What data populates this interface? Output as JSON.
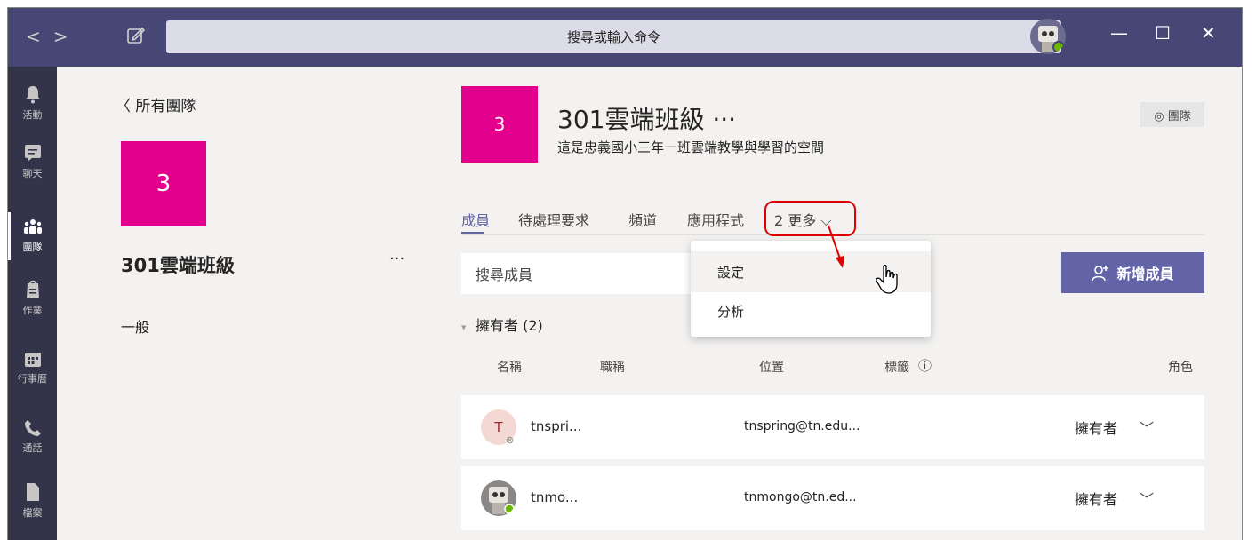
{
  "titlebar": {
    "search_placeholder": "搜尋或輸入命令",
    "min": "—",
    "max": "☐",
    "close": "✕"
  },
  "rail": [
    {
      "label": "活動",
      "icon": "bell-icon"
    },
    {
      "label": "聊天",
      "icon": "chat-icon"
    },
    {
      "label": "團隊",
      "icon": "teams-icon"
    },
    {
      "label": "作業",
      "icon": "assignments-icon"
    },
    {
      "label": "行事曆",
      "icon": "calendar-icon"
    },
    {
      "label": "通話",
      "icon": "phone-icon"
    },
    {
      "label": "檔案",
      "icon": "files-icon"
    }
  ],
  "teampanel": {
    "back_label": "所有團隊",
    "tile_label": "3",
    "team_name": "301雲端班級",
    "more": "···",
    "channel": "一般"
  },
  "main": {
    "tile_label": "3",
    "title": "301雲端班級 ···",
    "description": "這是忠義國小三年一班雲端教學與學習的空間",
    "team_button": "◎ 團隊",
    "tabs": [
      "成員",
      "待處理要求",
      "頻道",
      "應用程式",
      "2 更多 ⌵"
    ],
    "search_members": "搜尋成員",
    "add_member": "新增成員",
    "owners_header": "擁有者 (2)",
    "columns": [
      "名稱",
      "職稱",
      "位置",
      "標籤",
      "角色"
    ],
    "members": [
      {
        "initial": "T",
        "name": "tnspri...",
        "email": "tnspring@tn.edu...",
        "role": "擁有者"
      },
      {
        "initial": "",
        "name": "tnmo...",
        "email": "tnmongo@tn.ed...",
        "role": "擁有者"
      }
    ]
  },
  "dropdown": {
    "items": [
      "設定",
      "分析"
    ]
  },
  "colors": {
    "titlebar": "#464775",
    "rail": "#33344a",
    "accent": "#6264a7",
    "team_tile": "#e3008c",
    "highlight": "#e00000"
  }
}
